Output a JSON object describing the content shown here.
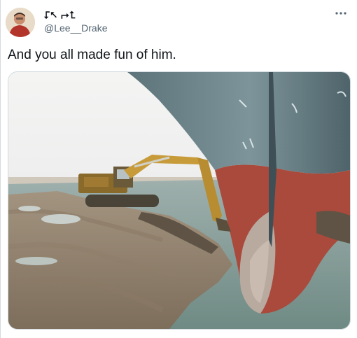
{
  "tweet": {
    "display_name": "⮦⭦ ⮣⮤",
    "handle": "@Lee__Drake",
    "text": "And you all made fun of him.",
    "more_icon": "ellipsis-icon",
    "media_alt": "Excavator digging beside the bow of the grounded container ship"
  },
  "colors": {
    "text_primary": "#0f1419",
    "text_secondary": "#536471",
    "border": "#cfd9de"
  }
}
